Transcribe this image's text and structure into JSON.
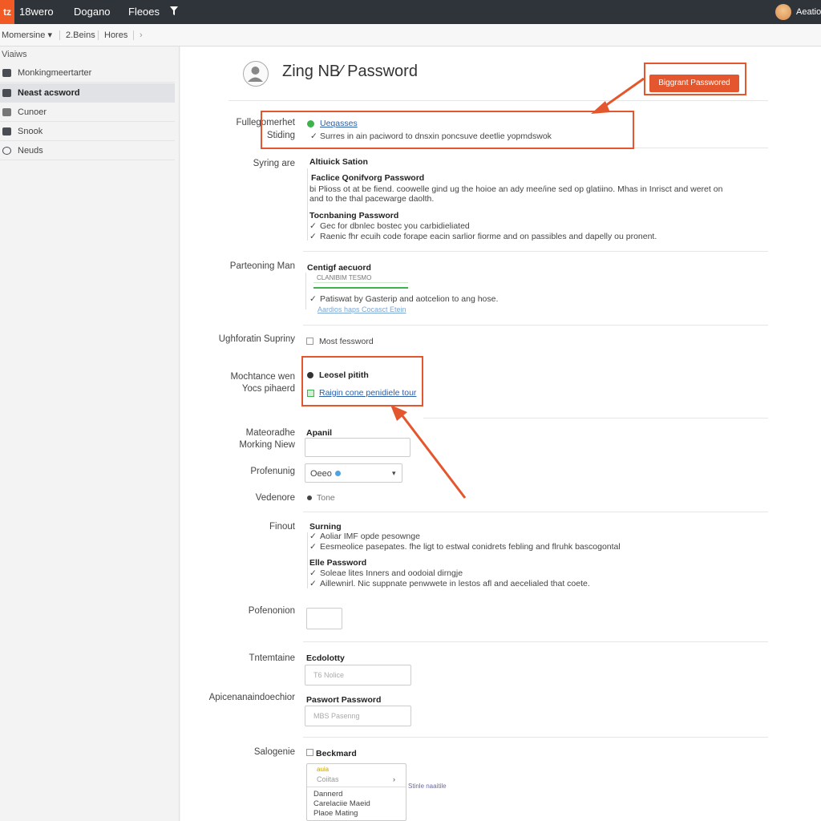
{
  "topbar": {
    "logo": "tz",
    "nav": [
      "18wero",
      "Dogano",
      "Fleoes"
    ],
    "user": "Aeatio"
  },
  "subbar": {
    "items": [
      "Momersine ▾",
      "2.Beins",
      "Hores",
      "›"
    ]
  },
  "sidebar": {
    "header": "Viaiws",
    "items": [
      {
        "label": "Monkingmeertarter",
        "active": false
      },
      {
        "label": "Neast acsword",
        "active": true
      },
      {
        "label": "Cunoer",
        "active": false
      },
      {
        "label": "Snook",
        "active": false
      },
      {
        "label": "Neuds",
        "active": false
      }
    ]
  },
  "page": {
    "title": "Zing NB⁄ Password",
    "primary_button": "Biggrant Passwored"
  },
  "sections": {
    "fullge": {
      "label1": "Fullegomerhet",
      "label2": "Stiding",
      "line1": "Ueqasses",
      "line2": "Surres in ain paciword to dnsxin poncsuve deetlie yopmdswok"
    },
    "syring": {
      "label": "Syring are",
      "heading": "Altiuick Sation",
      "item1_title": "Faclice Qonifvorg Password",
      "item1_text_a": "bi Plioss ot at be fiend. coowelle gind ug the hoioe an ady mee/ine sed op glatiino. Mhas in Inrisct and weret on",
      "item1_text_b": "and to the thal pacewarge daolth.",
      "item2_title": "Tocnbaning Password",
      "item2_line1": "Gec for dbnlec bostec you carbidieliated",
      "item2_line2": "Raenic fhr ecuih code forape eacin sarlior fiorme and on passibles and dapelly ou pronent."
    },
    "parteoning": {
      "label": "Parteoning Man",
      "title": "Centigf aecuord",
      "input_text": "CLANIBIM TESMO",
      "line1": "Patiswat by Gasterip and aotcelion to ang hose.",
      "link": "Aardios haps Cocasct Etein"
    },
    "ughforatin": {
      "label": "Ughforatin Supriny",
      "option": "Most fessword"
    },
    "mochance": {
      "label1": "Mochtance wen",
      "label2": "Yocs pihaerd",
      "option1": "Leosel pitith",
      "option2": "Raigin cone penidiele tour"
    },
    "mateoradhe": {
      "label1": "Mateoradhe",
      "label2": "Morking Niew",
      "title": "Apanil"
    },
    "profenunig": {
      "label": "Profenunig",
      "select_value": "Oeeo"
    },
    "vedenore": {
      "label": "Vedenore",
      "value": "Tone"
    },
    "finout": {
      "label": "Finout",
      "title1": "Surning",
      "line1": "Aoliar IMF opde pesownge",
      "line2": "Eesmeolice pasepates. fhe ligt to estwal conidrets febling and flruhk bascogontal",
      "title2": "Elle Password",
      "line3": "Soleae lites Inners and oodoial dirngje",
      "line4": "Aillewnirl. Nic suppnate penwwete in lestos afl and aecelialed that coete."
    },
    "pofenonion": {
      "label": "Pofenonion"
    },
    "tntemtaine": {
      "label": "Tntemtaine",
      "title": "Ecdolotty",
      "placeholder": "T6 Nolice"
    },
    "apicenana": {
      "label": "Apicenanaindoechior",
      "title": "Paswort Password",
      "placeholder": "MBS Pasenng"
    },
    "salogenie": {
      "label": "Salogenie",
      "checkbox": "Beckmard",
      "dropdown_hint": "auia",
      "dropdown_selected": "Coiitas",
      "side_link": "Stinle naaitile",
      "options": [
        "Dannerd",
        "Carelaciie Maeid",
        "Plaoe Mating"
      ]
    }
  },
  "colors": {
    "accent": "#e4572e",
    "topbar": "#2f333a",
    "success": "#3cb44b"
  }
}
